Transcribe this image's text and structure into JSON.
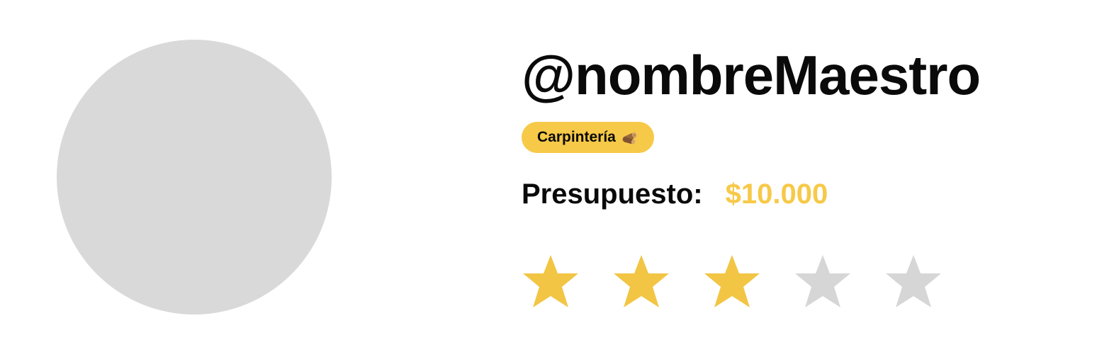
{
  "profile": {
    "username": "@nombreMaestro",
    "avatar_color": "#d9d9d9"
  },
  "category": {
    "label": "Carpintería",
    "icon": "wood-logs-icon",
    "color": "#f7c948"
  },
  "budget": {
    "label": "Presupuesto:",
    "value": "$10.000",
    "value_color": "#f7c948"
  },
  "rating": {
    "value": 3,
    "max": 5,
    "filled_color": "#f2c544",
    "empty_color": "#d6d6d6"
  }
}
